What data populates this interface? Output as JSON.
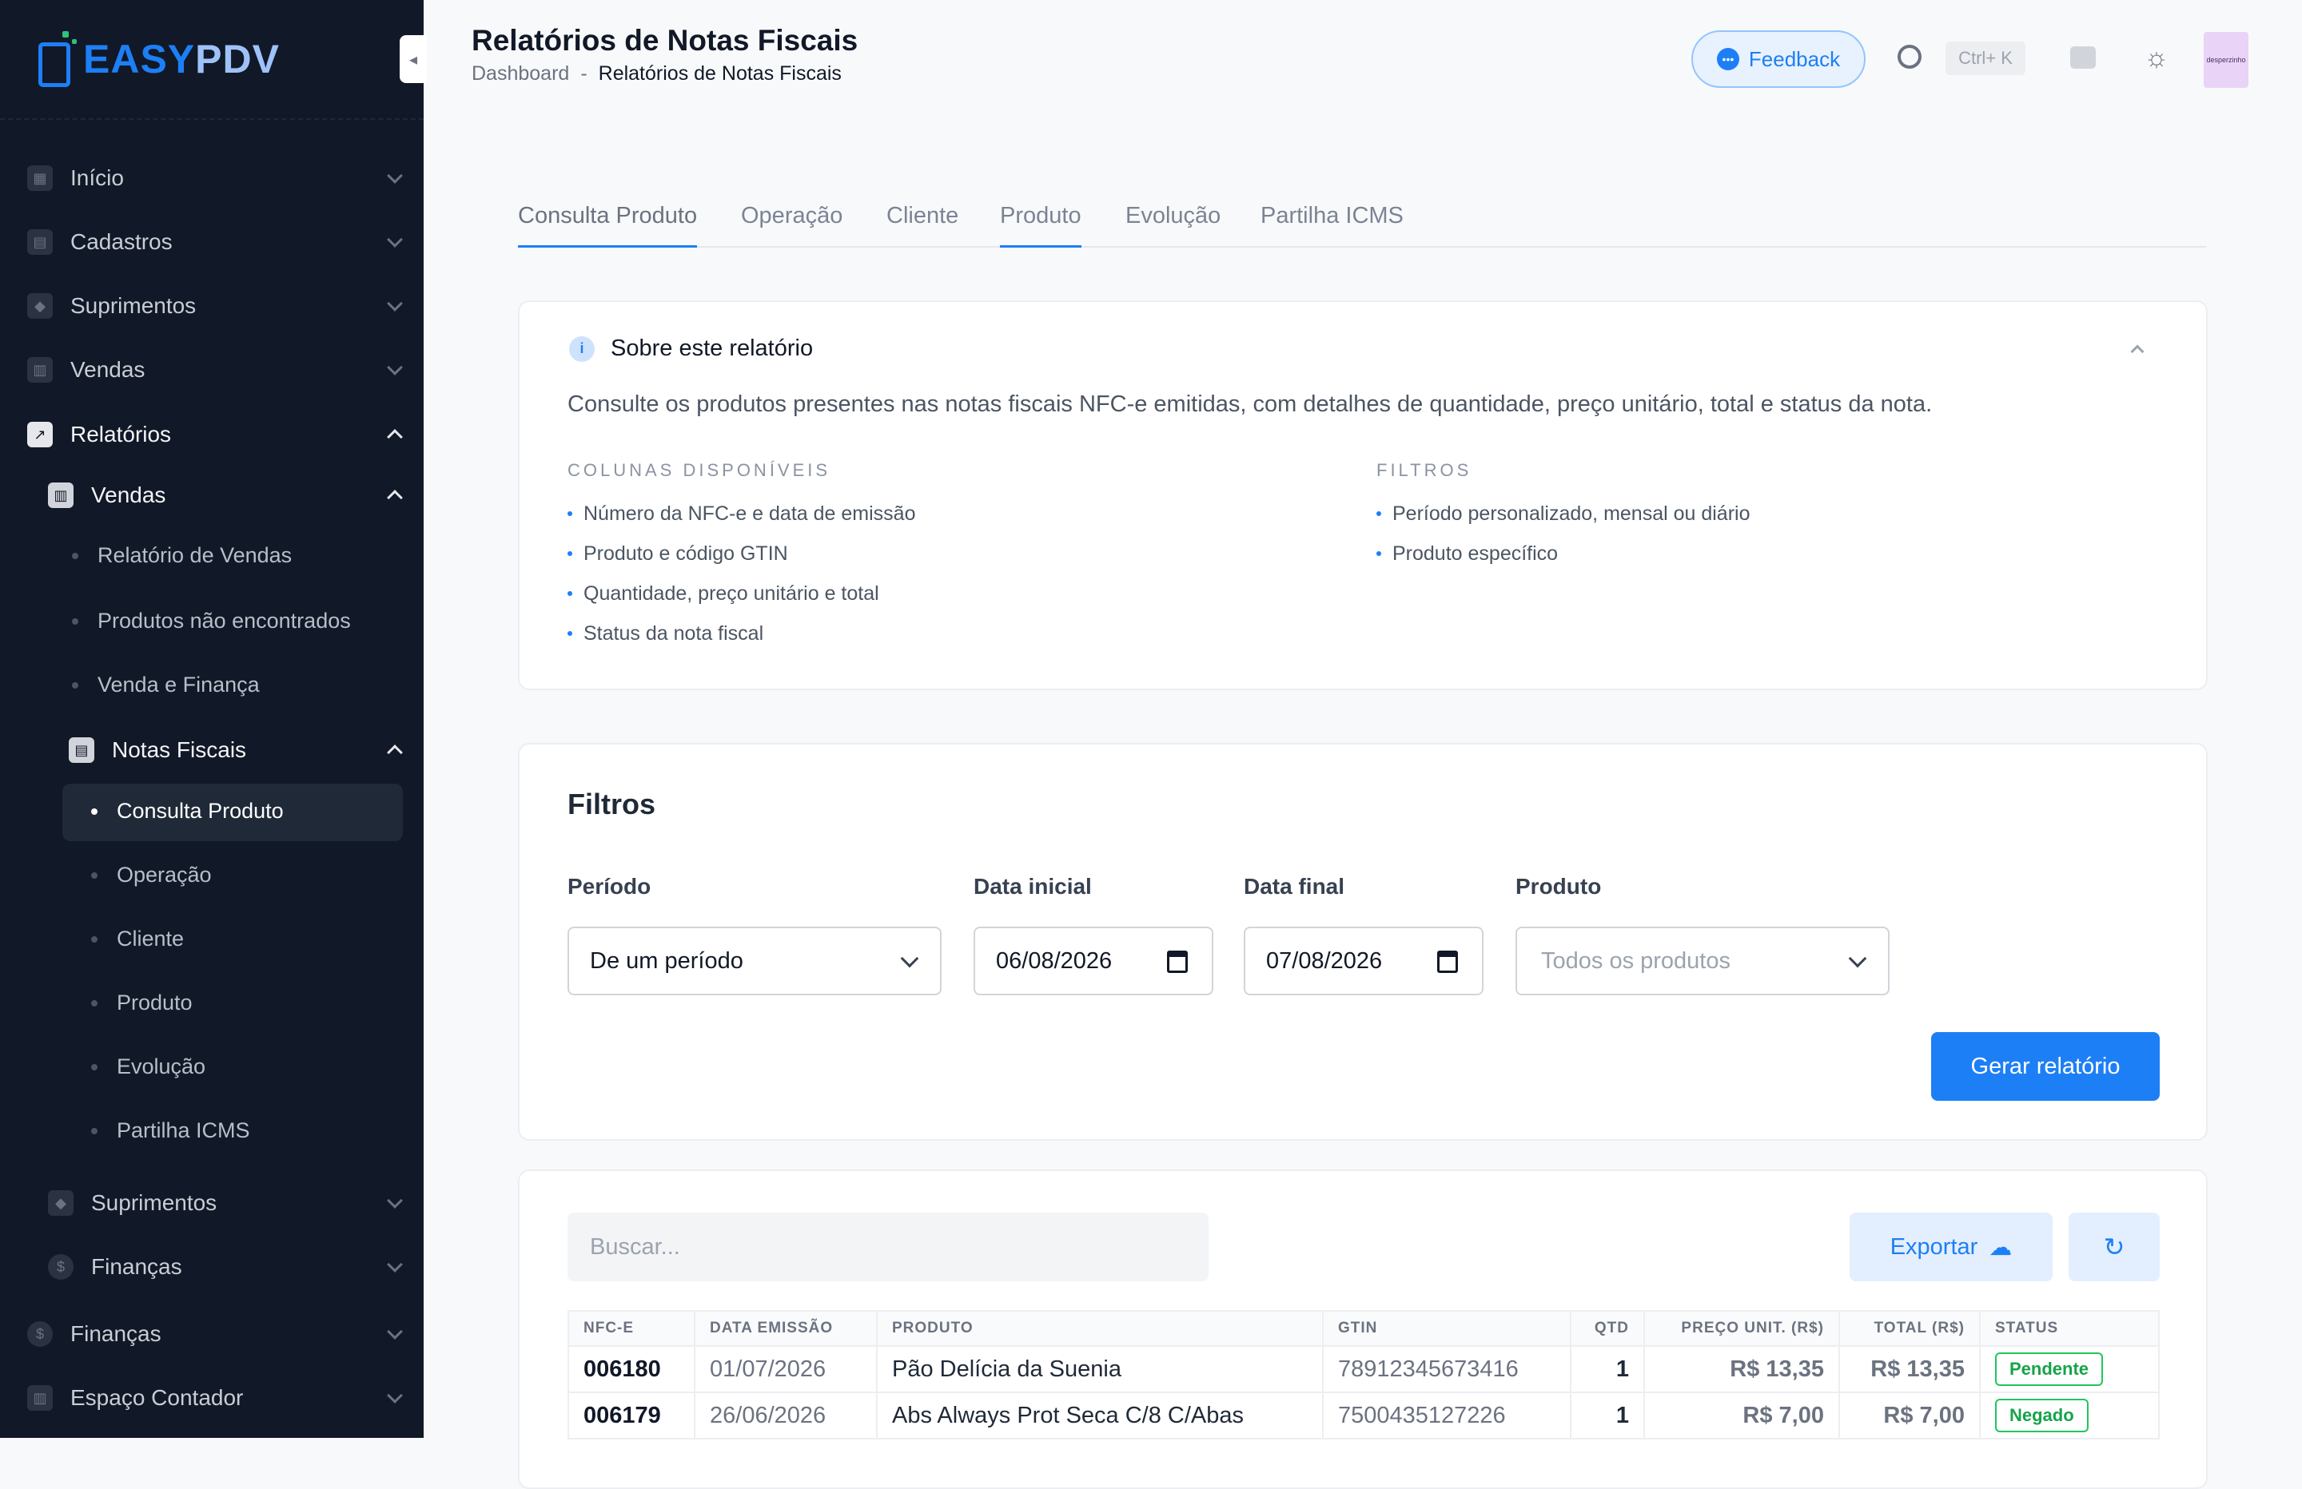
{
  "brand": {
    "part1": "EASY",
    "part2": "PDV"
  },
  "sidebar": {
    "items": [
      {
        "label": "Início",
        "icon": "grid-icon"
      },
      {
        "label": "Cadastros",
        "icon": "id-card-icon"
      },
      {
        "label": "Suprimentos",
        "icon": "box-icon"
      },
      {
        "label": "Vendas",
        "icon": "calculator-icon"
      },
      {
        "label": "Relatórios",
        "icon": "chart-icon"
      }
    ],
    "relatorios_sub": {
      "vendas": "Vendas",
      "vendas_items": [
        "Relatório de Vendas",
        "Produtos não encontrados",
        "Venda e Finança"
      ],
      "notas": "Notas Fiscais",
      "notas_items": [
        "Consulta Produto",
        "Operação",
        "Cliente",
        "Produto",
        "Evolução",
        "Partilha ICMS"
      ],
      "suprimentos": "Suprimentos",
      "financas": "Finanças"
    },
    "bottom_items": [
      {
        "label": "Finanças",
        "icon": "dollar-icon"
      },
      {
        "label": "Espaço Contador",
        "icon": "calculator-icon"
      }
    ]
  },
  "header": {
    "title": "Relatórios de Notas Fiscais",
    "breadcrumb_home": "Dashboard",
    "breadcrumb_sep": "-",
    "breadcrumb_current": "Relatórios de Notas Fiscais",
    "feedback": "Feedback",
    "shortcut": "Ctrl+ K",
    "avatar_text": "desperzinho"
  },
  "tabs": [
    "Consulta Produto",
    "Operação",
    "Cliente",
    "Produto",
    "Evolução",
    "Partilha ICMS"
  ],
  "about": {
    "title": "Sobre este relatório",
    "description": "Consulte os produtos presentes nas notas fiscais NFC-e emitidas, com detalhes de quantidade, preço unitário, total e status da nota.",
    "columns_title": "COLUNAS DISPONÍVEIS",
    "columns": [
      "Número da NFC-e e data de emissão",
      "Produto e código GTIN",
      "Quantidade, preço unitário e total",
      "Status da nota fiscal"
    ],
    "filters_title": "FILTROS",
    "filters": [
      "Período personalizado, mensal ou diário",
      "Produto específico"
    ]
  },
  "filters": {
    "title": "Filtros",
    "periodo_label": "Período",
    "periodo_value": "De um período",
    "data_inicial_label": "Data inicial",
    "data_inicial_value": "06/08/2026",
    "data_final_label": "Data final",
    "data_final_value": "07/08/2026",
    "produto_label": "Produto",
    "produto_placeholder": "Todos os produtos",
    "generate": "Gerar relatório"
  },
  "table": {
    "search_placeholder": "Buscar...",
    "export": "Exportar",
    "headers": [
      "NFC-E",
      "DATA EMISSÃO",
      "PRODUTO",
      "GTIN",
      "QTD",
      "PREÇO UNIT. (R$)",
      "TOTAL (R$)",
      "STATUS"
    ],
    "rows": [
      {
        "nfce": "006180",
        "data": "01/07/2026",
        "produto": "Pão Delícia da Suenia",
        "gtin": "78912345673416",
        "qtd": "1",
        "preco": "R$ 13,35",
        "total": "R$ 13,35",
        "status": "Pendente"
      },
      {
        "nfce": "006179",
        "data": "26/06/2026",
        "produto": "Abs Always Prot Seca C/8 C/Abas",
        "gtin": "7500435127226",
        "qtd": "1",
        "preco": "R$ 7,00",
        "total": "R$ 7,00",
        "status": "Negado"
      }
    ]
  },
  "colors": {
    "accent": "#1d7ff5",
    "sidebar_bg": "#111827",
    "success": "#22c55e"
  }
}
